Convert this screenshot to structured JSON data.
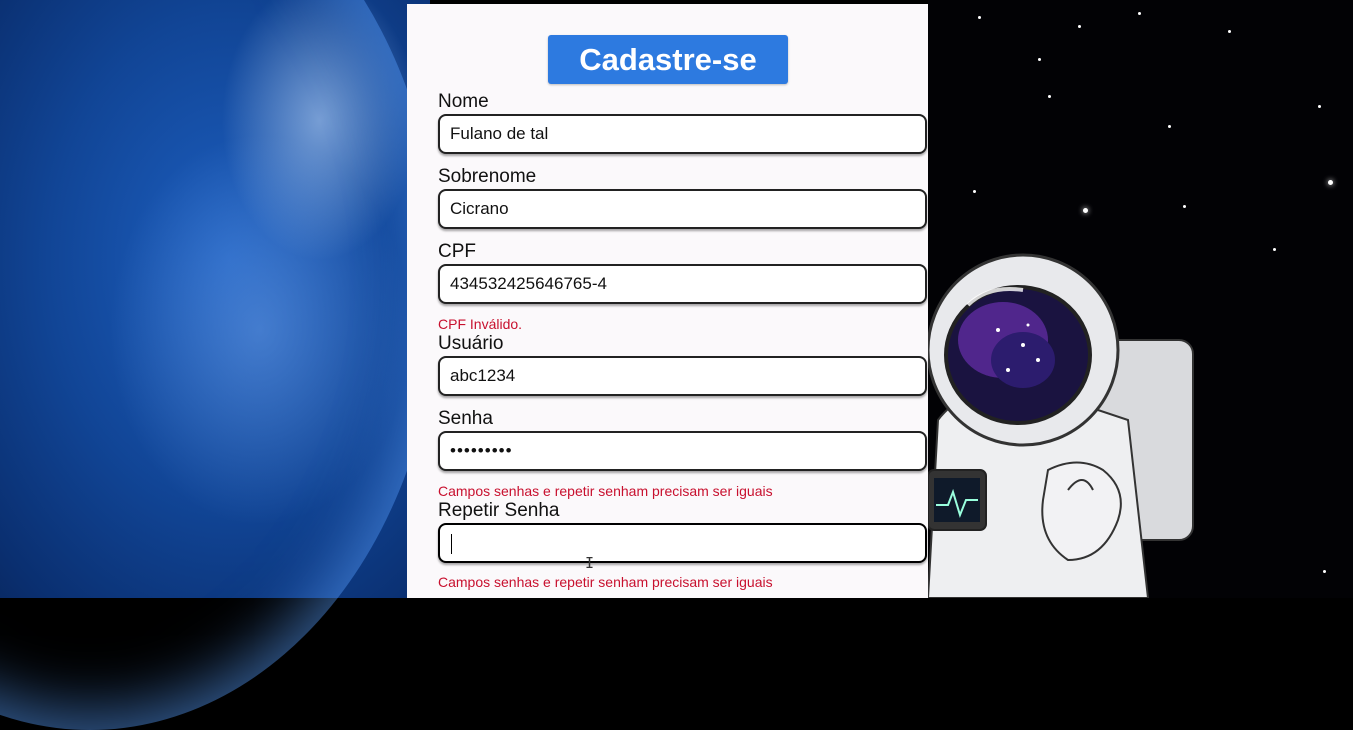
{
  "form": {
    "title": "Cadastre-se",
    "fields": [
      {
        "label": "Nome",
        "value": "Fulano de tal"
      },
      {
        "label": "Sobrenome",
        "value": "Cicrano"
      },
      {
        "label": "CPF",
        "value": "434532425646765-4",
        "error": "CPF Inválido."
      },
      {
        "label": "Usuário",
        "value": "abc1234"
      },
      {
        "label": "Senha",
        "value": "•••••••••",
        "error": "Campos senhas e repetir senham precisam ser iguais"
      },
      {
        "label": "Repetir Senha",
        "value": "",
        "error": "Campos senhas e repetir senham precisam ser iguais"
      }
    ]
  },
  "colors": {
    "title_bg": "#2d7ae0",
    "error": "#c8102e"
  }
}
